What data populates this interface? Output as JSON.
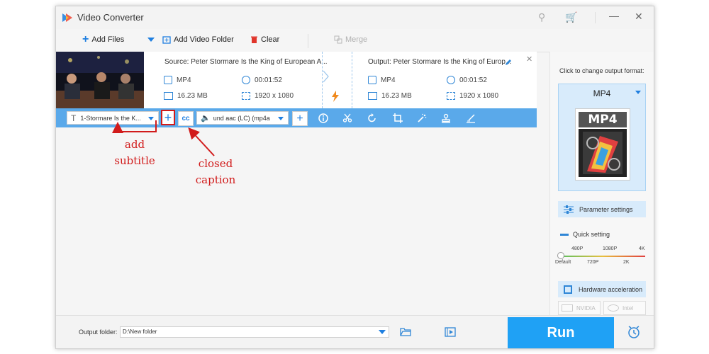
{
  "window": {
    "title": "Video Converter"
  },
  "toolbar": {
    "add_files": "Add Files",
    "add_video_folder": "Add Video Folder",
    "clear": "Clear",
    "merge": "Merge"
  },
  "task": {
    "source": {
      "title": "Source: Peter Stormare Is the King of European A...",
      "format": "MP4",
      "duration": "00:01:52",
      "size": "16.23 MB",
      "resolution": "1920 x 1080"
    },
    "output": {
      "title": "Output: Peter Stormare Is the King of Europ...",
      "format": "MP4",
      "duration": "00:01:52",
      "size": "16.23 MB",
      "resolution": "1920 x 1080"
    },
    "subtitle_select": "1-Stormare Is the K...",
    "audio_select": "und aac (LC) (mp4a"
  },
  "annotations": {
    "add_subtitle": [
      "add",
      "subtitle"
    ],
    "closed_caption": [
      "closed",
      "caption"
    ]
  },
  "right_panel": {
    "click_label": "Click to change output format:",
    "format": "MP4",
    "format_icon_text": "MP4",
    "parameter_settings": "Parameter settings",
    "quick_setting": "Quick setting",
    "slider_top": [
      "480P",
      "1080P",
      "4K"
    ],
    "slider_bottom": [
      "Default",
      "720P",
      "2K"
    ],
    "hardware_acceleration": "Hardware acceleration",
    "nvidia": "NVIDIA",
    "intel": "Intel"
  },
  "bottom": {
    "output_folder_label": "Output folder:",
    "output_folder_value": "D:\\New folder",
    "run": "Run"
  },
  "colors": {
    "accent": "#1fa1f5",
    "bar": "#5aa9ea",
    "annotation": "#d11b1b"
  }
}
